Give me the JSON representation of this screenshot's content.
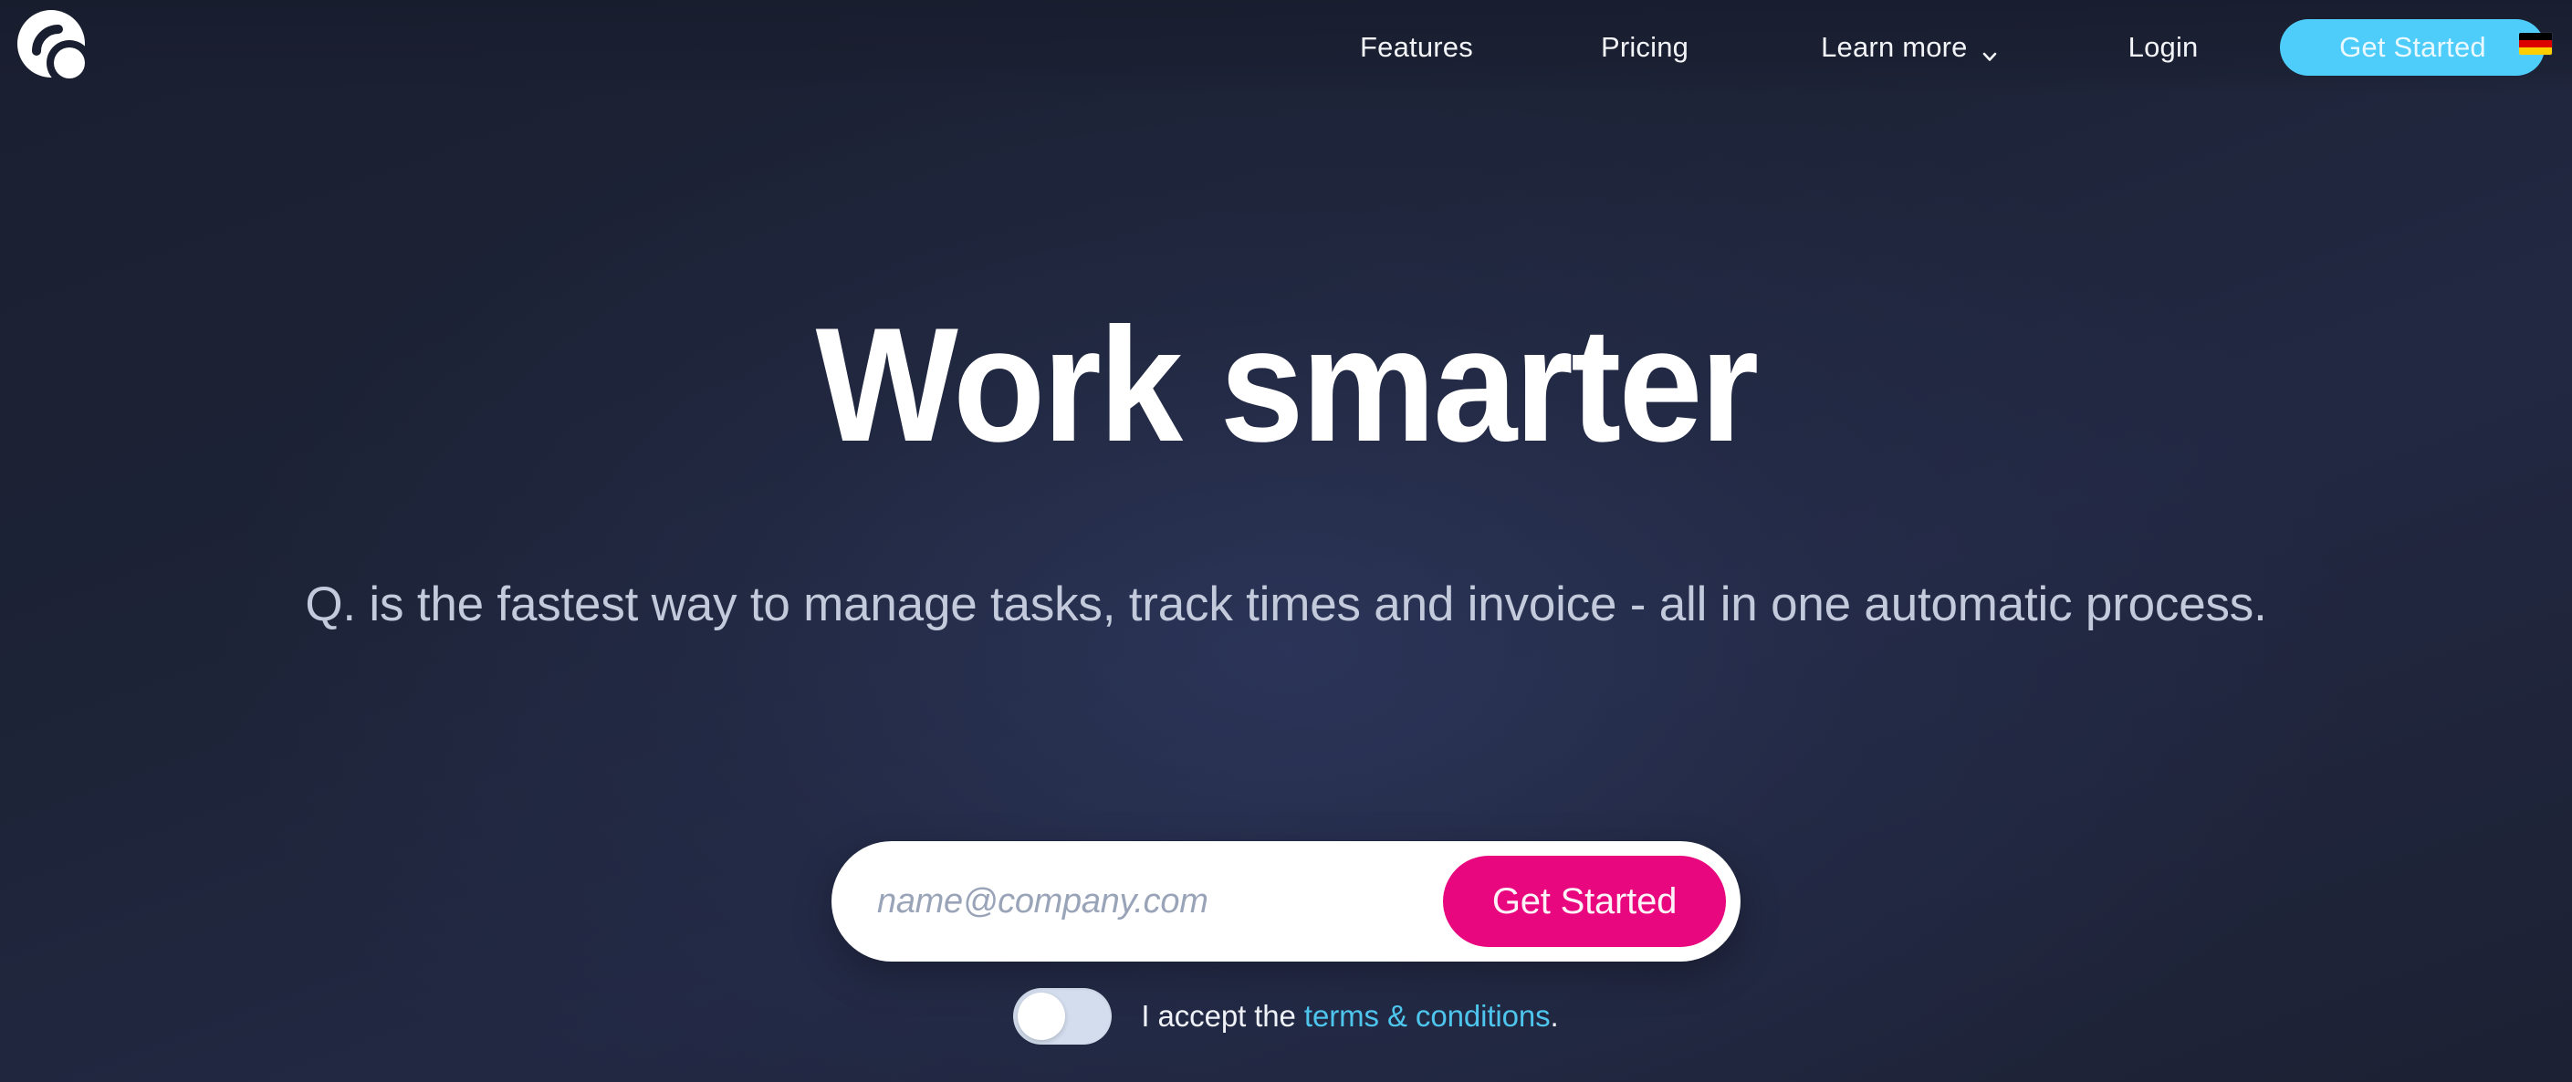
{
  "brand": {
    "logo_icon": "q-circle-logo-icon",
    "accent_cyan": "#4ecdfa",
    "accent_pink": "#e8077e",
    "background_dark": "#1b2032",
    "background_center": "#242c4e"
  },
  "header": {
    "nav": [
      {
        "label": "Features",
        "icon": null
      },
      {
        "label": "Pricing",
        "icon": null
      },
      {
        "label": "Learn more",
        "icon": "chevron-down-icon"
      },
      {
        "label": "Login",
        "icon": null
      }
    ],
    "cta_label": "Get Started",
    "language": {
      "icon": "german-flag-icon",
      "country": "Germany",
      "stripes": [
        "#000000",
        "#dd0000",
        "#ffce00"
      ]
    }
  },
  "hero": {
    "headline": "Work smarter",
    "subheadline": "Q. is the fastest way to manage tasks, track times and invoice - all in one automatic process."
  },
  "signup": {
    "email_placeholder": "name@company.com",
    "email_value": "",
    "cta_label": "Get Started"
  },
  "terms": {
    "toggle_state": "off",
    "text_before": "I accept the",
    "link_label": "terms & conditions",
    "text_after": "."
  }
}
